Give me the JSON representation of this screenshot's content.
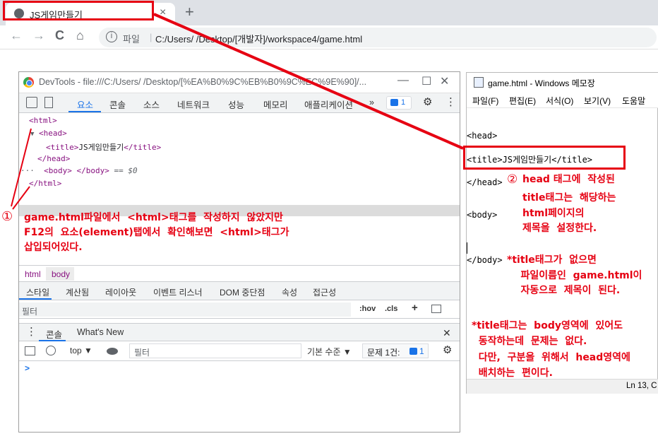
{
  "browser": {
    "tab_title": "JS게임만들기",
    "tab_close": "×",
    "new_tab": "+",
    "nav_back": "←",
    "nav_forward": "→",
    "nav_reload": "C",
    "nav_home": "⌂",
    "info_icon": "i",
    "file_label": "파일",
    "separator": "|",
    "url": "C:/Users/        /Desktop/[개발자]/workspace4/game.html"
  },
  "devtools": {
    "window_title": "DevTools - file:///C:/Users/        /Desktop/[%EA%B0%9C%EB%B0%9C%EC%9E%90]/...",
    "minimize": "—",
    "maximize": "☐",
    "close": "✕",
    "tabs": [
      "요소",
      "콘솔",
      "소스",
      "네트워크",
      "성능",
      "메모리",
      "애플리케이션"
    ],
    "more_tabs": "»",
    "issue_count": "1",
    "gear": "⚙",
    "kebab": "⋮",
    "tree": {
      "l1": "<html>",
      "l2_arrow": "▼",
      "l2": "<head>",
      "l3_open": "<title>",
      "l3_text": "JS게임만들기",
      "l3_close": "</title>",
      "l4": "</head>",
      "l5_dots": "···",
      "l5": "<body> </body>",
      "l5_eq": " == $0",
      "l6": "</html>"
    },
    "breadcrumbs": [
      "html",
      "body"
    ],
    "style_tabs": [
      "스타일",
      "계산됨",
      "레이아웃",
      "이벤트 리스너",
      "DOM 중단점",
      "속성",
      "접근성"
    ],
    "filter_placeholder": "필터",
    "hov": ":hov",
    "cls": ".cls",
    "plus": "+",
    "drawer_tabs": [
      "콘솔",
      "What's New"
    ],
    "drawer_close": "✕",
    "drawer_menu": "⋮",
    "console_context": "top ▼",
    "console_filter": "필터",
    "log_level": "기본 수준 ▼",
    "issues_label": "문제 1건:",
    "issues_count": "1",
    "prompt": ">"
  },
  "notepad": {
    "title": "game.html - Windows 메모장",
    "menu": [
      "파일(F)",
      "편집(E)",
      "서식(O)",
      "보기(V)",
      "도움말"
    ],
    "lines": [
      "<head>",
      "<title>JS게임만들기</title>",
      "</head>",
      "<body>",
      "</body>"
    ],
    "status": "Ln 13, C"
  },
  "annotations": {
    "note1_marker": "①",
    "note1": "game.html파일에서  <html>태그를  작성하지  않았지만\nF12의  요소(element)탭에서  확인해보면  <html>태그가\n삽입되어있다.",
    "note2_marker": "②",
    "note2_line1": "head 태그에  작성된",
    "note2_rest": "title태그는  해당하는\nhtml페이지의\n제목을  설정한다.",
    "note3": "*title태그가  없으면\n    파일이름인  game.html이\n    자동으로  제목이  된다.",
    "note4": "*title태그는  body영역에  있어도\n  동작하는데  문제는  없다.\n  다만,  구분을  위해서  head영역에\n  배치하는  편이다."
  }
}
